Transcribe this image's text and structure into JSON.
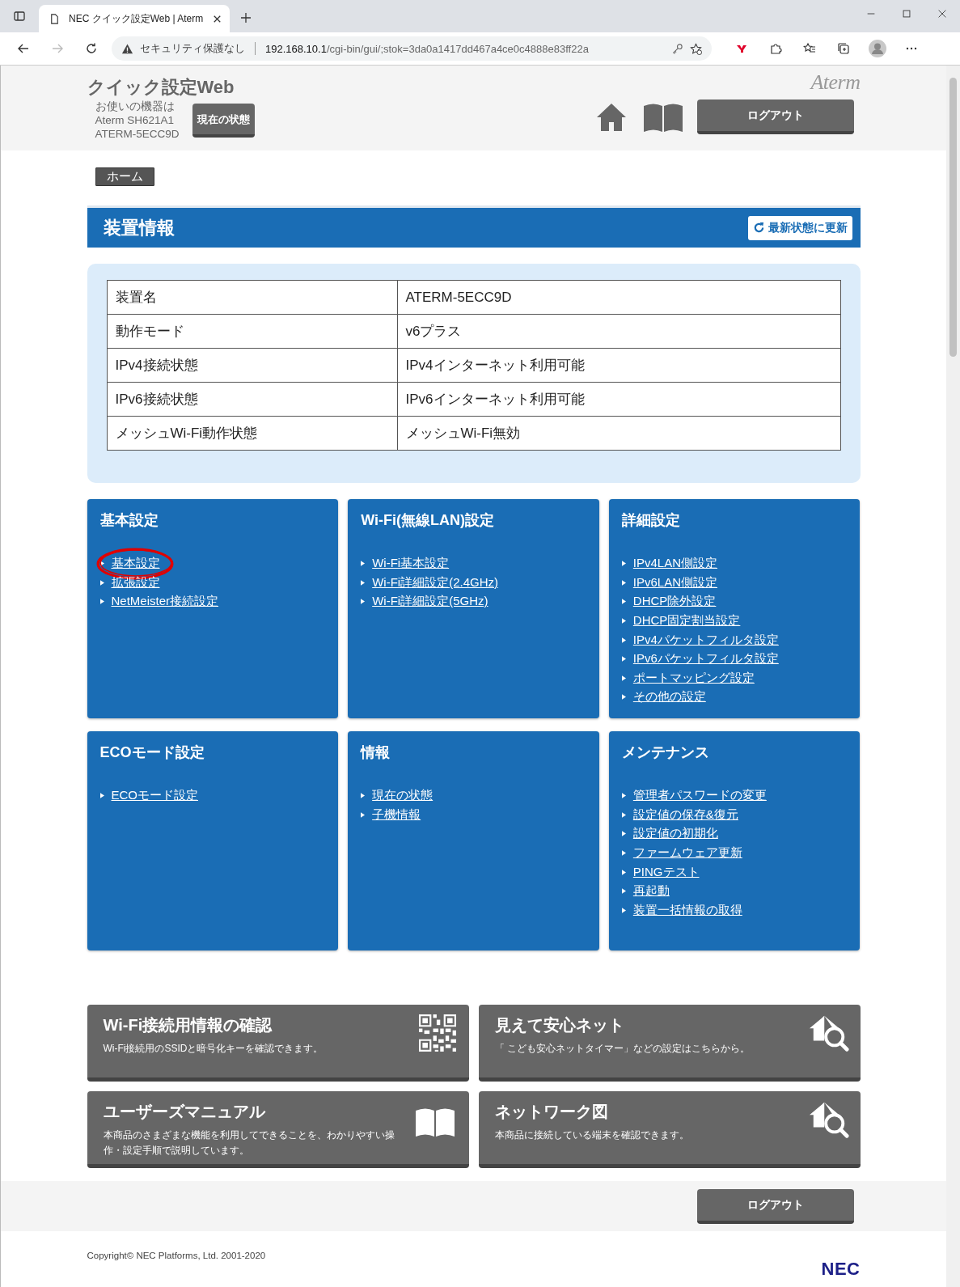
{
  "browser": {
    "tab_title": "NEC クイック設定Web | Aterm",
    "security": "セキュリティ保護なし",
    "url_host": "192.168.10.1",
    "url_path": "/cgi-bin/gui/;stok=3da0a1417dd467a4ce0c4888e83ff22a"
  },
  "header": {
    "title": "クイック設定Web",
    "device_lines": [
      "お使いの機器は",
      "Aterm SH621A1",
      "ATERM-5ECC9D"
    ],
    "status_button": "現在の状態",
    "logout": "ログアウト",
    "logo": "Aterm"
  },
  "breadcrumb": "ホーム",
  "section": {
    "title": "装置情報",
    "refresh": "最新状態に更新"
  },
  "info_rows": [
    {
      "label": "装置名",
      "value": "ATERM-5ECC9D"
    },
    {
      "label": "動作モード",
      "value": "v6プラス"
    },
    {
      "label": "IPv4接続状態",
      "value": "IPv4インターネット利用可能"
    },
    {
      "label": "IPv6接続状態",
      "value": "IPv6インターネット利用可能"
    },
    {
      "label": "メッシュWi-Fi動作状態",
      "value": "メッシュWi-Fi無効"
    }
  ],
  "menus": [
    {
      "title": "基本設定",
      "links": [
        {
          "label": "基本設定",
          "circled": true
        },
        {
          "label": "拡張設定",
          "circled": false
        },
        {
          "label": "NetMeister接続設定",
          "circled": false
        }
      ]
    },
    {
      "title": "Wi-Fi(無線LAN)設定",
      "links": [
        {
          "label": "Wi-Fi基本設定",
          "circled": false
        },
        {
          "label": "Wi-Fi詳細設定(2.4GHz)",
          "circled": false
        },
        {
          "label": "Wi-Fi詳細設定(5GHz)",
          "circled": false
        }
      ]
    },
    {
      "title": "詳細設定",
      "links": [
        {
          "label": "IPv4LAN側設定",
          "circled": false
        },
        {
          "label": "IPv6LAN側設定",
          "circled": false
        },
        {
          "label": "DHCP除外設定",
          "circled": false
        },
        {
          "label": "DHCP固定割当設定",
          "circled": false
        },
        {
          "label": "IPv4パケットフィルタ設定",
          "circled": false
        },
        {
          "label": "IPv6パケットフィルタ設定",
          "circled": false
        },
        {
          "label": "ポートマッピング設定",
          "circled": false
        },
        {
          "label": "その他の設定",
          "circled": false
        }
      ]
    },
    {
      "title": "ECOモード設定",
      "links": [
        {
          "label": "ECOモード設定",
          "circled": false
        }
      ]
    },
    {
      "title": "情報",
      "links": [
        {
          "label": "現在の状態",
          "circled": false
        },
        {
          "label": "子機情報",
          "circled": false
        }
      ]
    },
    {
      "title": "メンテナンス",
      "links": [
        {
          "label": "管理者パスワードの変更",
          "circled": false
        },
        {
          "label": "設定値の保存&復元",
          "circled": false
        },
        {
          "label": "設定値の初期化",
          "circled": false
        },
        {
          "label": "ファームウェア更新",
          "circled": false
        },
        {
          "label": "PINGテスト",
          "circled": false
        },
        {
          "label": "再起動",
          "circled": false
        },
        {
          "label": "装置一括情報の取得",
          "circled": false
        }
      ]
    }
  ],
  "shortcuts": [
    {
      "title": "Wi-Fi接続用情報の確認",
      "description": "Wi-Fi接続用のSSIDと暗号化キーを確認できます。",
      "kind": "qr"
    },
    {
      "title": "見えて安心ネット",
      "description": "「 こども安心ネットタイマー」などの設定はこちらから。",
      "kind": "house-search"
    },
    {
      "title": "ユーザーズマニュアル",
      "description": "本商品のさまざまな機能を利用してできることを、わかりやすい操作・設定手順で説明しています。",
      "kind": "book"
    },
    {
      "title": "ネットワーク図",
      "description": "本商品に接続している端末を確認できます。",
      "kind": "house-search"
    }
  ],
  "footer": {
    "logout": "ログアウト",
    "copyright": "Copyright© NEC Platforms, Ltd. 2001-2020",
    "brand": "NEC"
  }
}
